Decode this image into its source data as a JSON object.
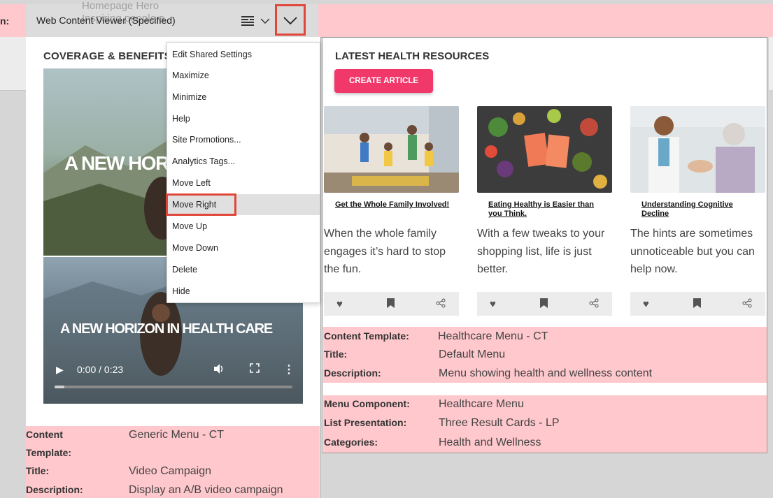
{
  "header": {
    "label_fragment": "n:",
    "ghost_text": "Homepage Hero\nInspiring people a",
    "portlet_title": "Web Content Viewer (Specified)"
  },
  "left": {
    "section_title": "COVERAGE & BENEFITS",
    "hero_text": "A NEW HOR",
    "video_text": "A NEW HORIZON IN HEALTH CARE",
    "video_time": "0:00 / 0:23",
    "video_progress": 0.04,
    "meta": {
      "content_template_label": "Content",
      "content_template_label2": "Template:",
      "content_template": "Generic Menu - CT",
      "title_label": "Title:",
      "title": "Video Campaign",
      "description_label": "Description:",
      "description": "Display an A/B video campaign"
    }
  },
  "menu": {
    "items": [
      "Edit Shared Settings",
      "Maximize",
      "Minimize",
      "Help",
      "Site Promotions...",
      "Analytics Tags...",
      "Move Left",
      "Move Right",
      "Move Up",
      "Move Down",
      "Delete",
      "Hide"
    ],
    "highlighted": "Move Right"
  },
  "right": {
    "section_title": "LATEST HEALTH RESOURCES",
    "create_button": "CREATE ARTICLE",
    "cards": [
      {
        "title": "Get the Whole Family Involved!",
        "description": "When the whole family engages it’s hard to stop the fun."
      },
      {
        "title": "Eating Healthy is Easier than you Think.",
        "description": "With a few tweaks to your shopping list, life is just better."
      },
      {
        "title": "Understanding Cognitive Decline",
        "description": "The hints are sometimes unnoticeable but you can help now."
      }
    ],
    "meta1": {
      "content_template_label": "Content Template:",
      "content_template": "Healthcare Menu - CT",
      "title_label": "Title:",
      "title": "Default Menu",
      "description_label": "Description:",
      "description": "Menu showing health and wellness content"
    },
    "meta2": {
      "menu_component_label": "Menu Component:",
      "menu_component": "Healthcare Menu",
      "list_presentation_label": "List Presentation:",
      "list_presentation": "Three Result Cards - LP",
      "categories_label": "Categories:",
      "categories": "Health and Wellness"
    }
  },
  "colors": {
    "pink_band": "#ffc8cd",
    "accent_red": "#e0473a",
    "create_pink": "#f0386b"
  }
}
